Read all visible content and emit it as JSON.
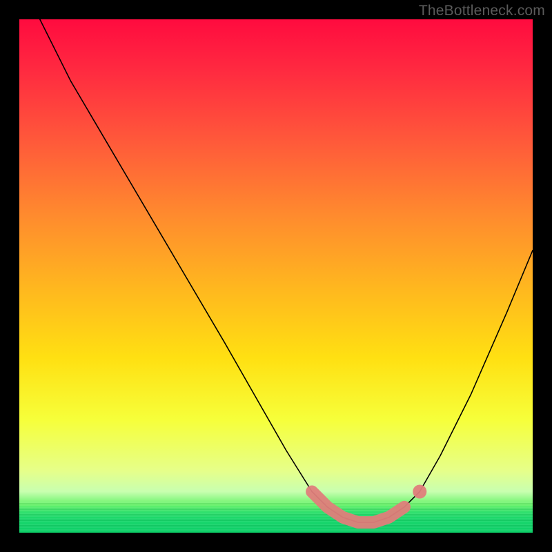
{
  "watermark": "TheBottleneck.com",
  "chart_data": {
    "type": "line",
    "title": "",
    "xlabel": "",
    "ylabel": "",
    "xlim": [
      0,
      100
    ],
    "ylim": [
      0,
      100
    ],
    "grid": false,
    "legend": "none",
    "series": [
      {
        "name": "bottleneck-curve",
        "color": "#000000",
        "x": [
          4,
          10,
          20,
          30,
          40,
          48,
          52,
          57,
          60,
          63,
          66,
          69,
          72,
          75,
          78,
          82,
          88,
          95,
          100
        ],
        "y": [
          100,
          88,
          71,
          54,
          37,
          23,
          16,
          8,
          5,
          3,
          2,
          2,
          3,
          5,
          8,
          15,
          27,
          43,
          55
        ]
      },
      {
        "name": "highlight-marker",
        "color": "#e07a78",
        "x": [
          57,
          60,
          63,
          66,
          69,
          72,
          75,
          78
        ],
        "y": [
          8,
          5,
          3,
          2,
          2,
          3,
          5,
          8
        ]
      }
    ],
    "color_scale": {
      "orientation": "vertical",
      "stops": [
        {
          "pos": 0,
          "color": "#ff0b3f"
        },
        {
          "pos": 24,
          "color": "#ff5a3a"
        },
        {
          "pos": 52,
          "color": "#ffb61f"
        },
        {
          "pos": 78,
          "color": "#f6ff3a"
        },
        {
          "pos": 92,
          "color": "#c8ffb0"
        },
        {
          "pos": 100,
          "color": "#0ecf68"
        }
      ]
    }
  }
}
